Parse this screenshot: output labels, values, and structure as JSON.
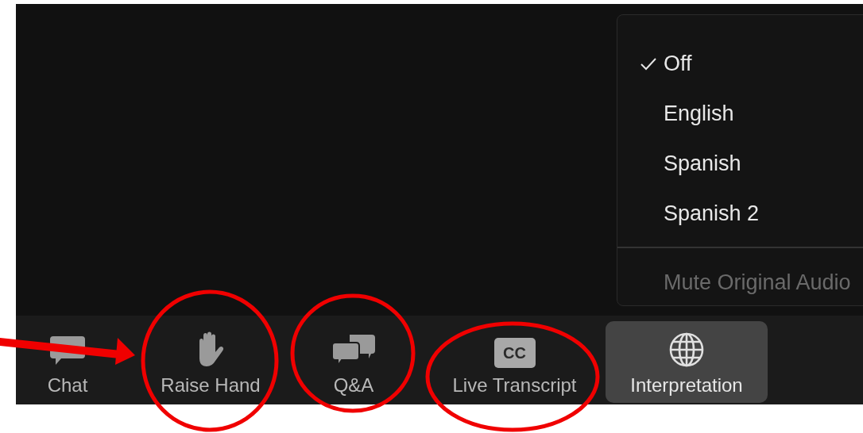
{
  "interpretation_menu": {
    "options": [
      {
        "label": "Off",
        "checked": true
      },
      {
        "label": "English",
        "checked": false
      },
      {
        "label": "Spanish",
        "checked": false
      },
      {
        "label": "Spanish 2",
        "checked": false
      }
    ],
    "mute_original_audio": {
      "label": "Mute Original Audio",
      "disabled": true
    }
  },
  "toolbar": {
    "buttons": [
      {
        "kind": "chat",
        "label": "Chat",
        "selected": false,
        "circled": false
      },
      {
        "kind": "hand",
        "label": "Raise Hand",
        "selected": false,
        "circled": true
      },
      {
        "kind": "qa",
        "label": "Q&A",
        "selected": false,
        "circled": true
      },
      {
        "kind": "cc",
        "icon_text": "CC",
        "label": "Live Transcript",
        "selected": false,
        "circled": true
      },
      {
        "kind": "globe",
        "label": "Interpretation",
        "selected": true,
        "circled": false
      }
    ]
  }
}
